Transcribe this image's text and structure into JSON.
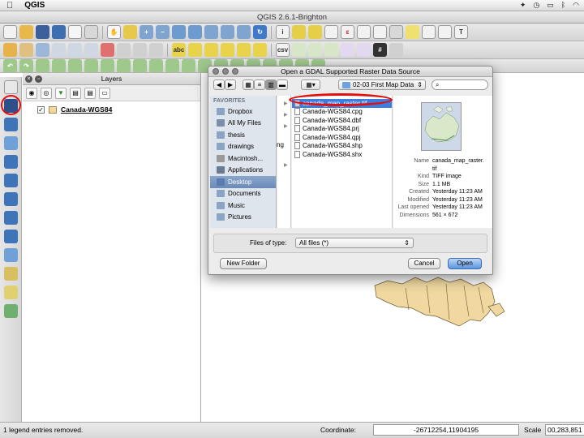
{
  "menubar": {
    "app_name": "QGIS",
    "apple": ""
  },
  "window": {
    "title": "QGIS 2.6.1-Brighton"
  },
  "layers_panel": {
    "title": "Layers",
    "layer_name": "Canada-WGS84"
  },
  "dialog": {
    "title": "Open a GDAL Supported Raster Data Source",
    "current_folder": "02-03 First Map Data",
    "sidebar_header": "FAVORITES",
    "favorites": [
      {
        "label": "Dropbox",
        "icon": "folder-icon",
        "selected": false
      },
      {
        "label": "All My Files",
        "icon": "all-files-icon",
        "selected": false
      },
      {
        "label": "thesis",
        "icon": "folder-icon",
        "selected": false
      },
      {
        "label": "drawings",
        "icon": "folder-icon",
        "selected": false
      },
      {
        "label": "Macintosh...",
        "icon": "disk-icon",
        "selected": false
      },
      {
        "label": "Applications",
        "icon": "applications-icon",
        "selected": false
      },
      {
        "label": "Desktop",
        "icon": "desktop-icon",
        "selected": true
      },
      {
        "label": "Documents",
        "icon": "documents-icon",
        "selected": false
      },
      {
        "label": "Music",
        "icon": "music-icon",
        "selected": false
      },
      {
        "label": "Pictures",
        "icon": "pictures-icon",
        "selected": false
      }
    ],
    "column1_partial_text": "ng",
    "files": [
      {
        "name": "canada_map_raster.tif",
        "selected": true
      },
      {
        "name": "Canada-WGS84.cpg",
        "selected": false
      },
      {
        "name": "Canada-WGS84.dbf",
        "selected": false
      },
      {
        "name": "Canada-WGS84.prj",
        "selected": false
      },
      {
        "name": "Canada-WGS84.qpj",
        "selected": false
      },
      {
        "name": "Canada-WGS84.shp",
        "selected": false
      },
      {
        "name": "Canada-WGS84.shx",
        "selected": false
      }
    ],
    "preview": [
      {
        "key": "Name",
        "value": "canada_map_raster."
      },
      {
        "key": "",
        "value": "tif"
      },
      {
        "key": "Kind",
        "value": "TIFF image"
      },
      {
        "key": "Size",
        "value": "1.1 MB"
      },
      {
        "key": "Created",
        "value": "Yesterday 11:23 AM"
      },
      {
        "key": "Modified",
        "value": "Yesterday 11:23 AM"
      },
      {
        "key": "Last opened",
        "value": "Yesterday 11:23 AM"
      },
      {
        "key": "Dimensions",
        "value": "561 × 672"
      }
    ],
    "file_type_label": "Files of type:",
    "file_type_value": "All files (*)",
    "new_folder_label": "New Folder",
    "cancel_label": "Cancel",
    "open_label": "Open"
  },
  "statusbar": {
    "message": "1 legend entries removed.",
    "coordinate_label": "Coordinate:",
    "coordinate_value": "-26712254,11904195",
    "scale_label": "Scale",
    "scale_value": "00,283,851"
  },
  "colors": {
    "highlight_circle": "#e01010",
    "selection": "#3b7ee0",
    "map_fill": "#f0d8a0"
  }
}
